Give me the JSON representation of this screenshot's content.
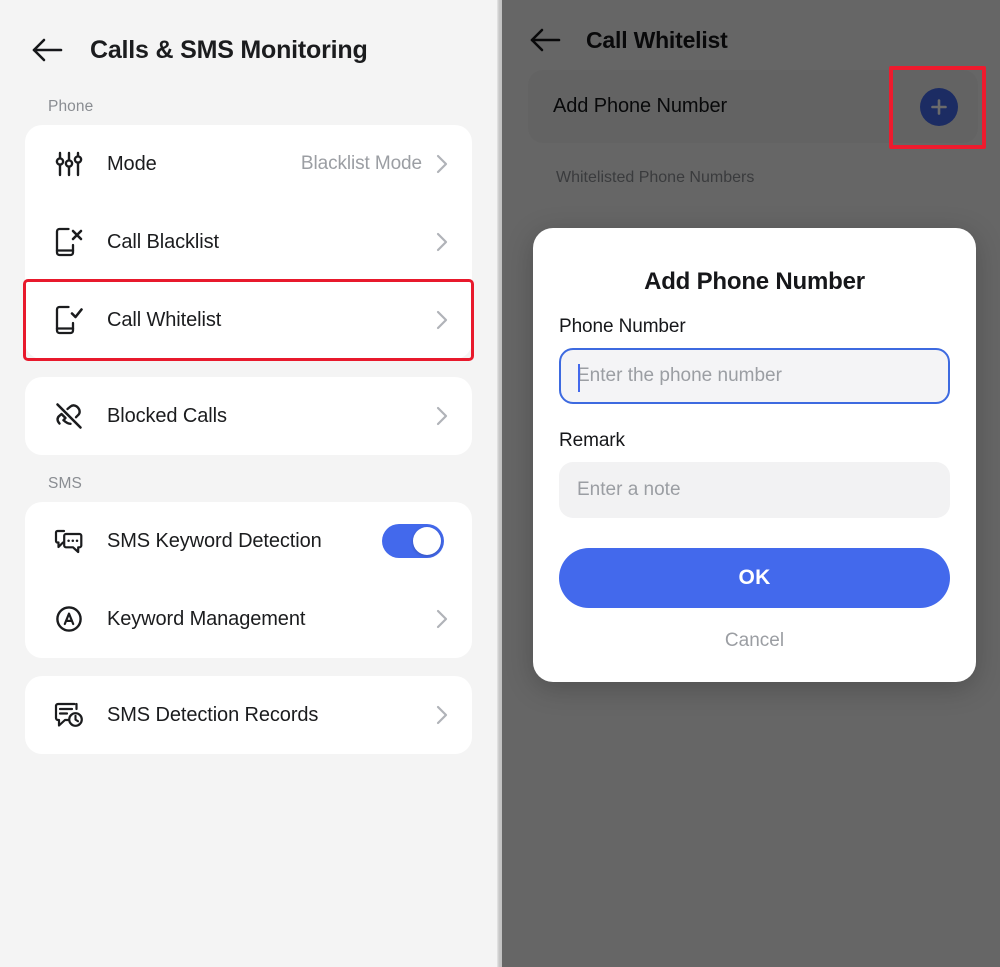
{
  "theme": {
    "accent_blue": "#4369ec",
    "highlight_red": "#ee1b2e",
    "page_bg": "#f4f4f4",
    "card_bg": "#ffffff",
    "muted_text": "#9b9ea3"
  },
  "left_screen": {
    "back_icon": "arrow-left-icon",
    "title": "Calls & SMS Monitoring",
    "sections": [
      {
        "label": "Phone",
        "groups": [
          {
            "rows": [
              {
                "icon": "sliders-icon",
                "label": "Mode",
                "value": "Blacklist Mode",
                "accessory": "chevron-right-icon",
                "highlighted": false
              },
              {
                "icon": "phone-block-x-icon",
                "label": "Call Blacklist",
                "value": "",
                "accessory": "chevron-right-icon",
                "highlighted": false
              },
              {
                "icon": "phone-check-icon",
                "label": "Call Whitelist",
                "value": "",
                "accessory": "chevron-right-icon",
                "highlighted": true
              }
            ]
          },
          {
            "rows": [
              {
                "icon": "call-slash-icon",
                "label": "Blocked Calls",
                "value": "",
                "accessory": "chevron-right-icon",
                "highlighted": false
              }
            ]
          }
        ]
      },
      {
        "label": "SMS",
        "groups": [
          {
            "rows": [
              {
                "icon": "sms-bubbles-icon",
                "label": "SMS Keyword Detection",
                "value": "",
                "accessory": "toggle-on",
                "highlighted": false
              },
              {
                "icon": "letter-a-circle-icon",
                "label": "Keyword Management",
                "value": "",
                "accessory": "chevron-right-icon",
                "highlighted": false
              }
            ]
          },
          {
            "rows": [
              {
                "icon": "sms-clock-icon",
                "label": "SMS Detection Records",
                "value": "",
                "accessory": "chevron-right-icon",
                "highlighted": false
              }
            ]
          }
        ]
      }
    ]
  },
  "right_screen": {
    "back_icon": "arrow-left-icon",
    "title": "Call Whitelist",
    "add_row": {
      "label": "Add Phone Number",
      "button_icon": "plus-icon",
      "highlighted": true
    },
    "list_label": "Whitelisted Phone Numbers",
    "modal": {
      "title": "Add Phone Number",
      "phone_label": "Phone Number",
      "phone_placeholder": "Enter the phone number",
      "phone_value": "",
      "phone_focused": true,
      "remark_label": "Remark",
      "remark_placeholder": "Enter a note",
      "remark_value": "",
      "confirm_label": "OK",
      "cancel_label": "Cancel"
    }
  }
}
